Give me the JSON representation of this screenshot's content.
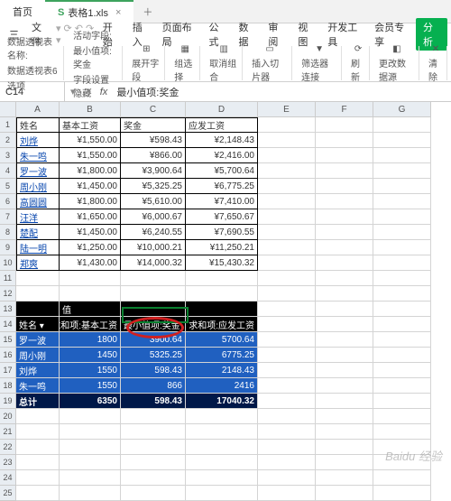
{
  "tabs": {
    "home": "首页",
    "file": "表格1.xls",
    "fileIcon": "S"
  },
  "menu": {
    "app": "三",
    "file": "文件",
    "items": [
      "开始",
      "插入",
      "页面布局",
      "公式",
      "数据",
      "审阅",
      "视图",
      "开发工具",
      "会员专享"
    ],
    "active": "分析"
  },
  "toolbar": {
    "g1a": "数据透视表名称:",
    "g1b": "数据透视表6",
    "g1c": "选项",
    "g2a": "活动字段:",
    "g2b": "最小值项:奖金",
    "g2c": "字段设置",
    "g2d": "隐藏",
    "g3": "展开字段",
    "g4": "组选择",
    "g5": "取消组合",
    "g6": "插入切片器",
    "g7": "筛选器连接",
    "g8": "刷新",
    "g9": "更改数据源",
    "g10": "清除"
  },
  "ref": {
    "cell": "C14",
    "formula": "最小值项:奖金",
    "fx": "fx"
  },
  "cols": [
    "A",
    "B",
    "C",
    "D",
    "E",
    "F",
    "G"
  ],
  "headers": {
    "name": "姓名",
    "base": "基本工资",
    "bonus": "奖金",
    "pay": "应发工资"
  },
  "rows": [
    {
      "n": "刘烨",
      "b": "¥1,550.00",
      "bo": "¥598.43",
      "p": "¥2,148.43"
    },
    {
      "n": "朱一鸣",
      "b": "¥1,550.00",
      "bo": "¥866.00",
      "p": "¥2,416.00"
    },
    {
      "n": "罗一波",
      "b": "¥1,800.00",
      "bo": "¥3,900.64",
      "p": "¥5,700.64"
    },
    {
      "n": "周小刚",
      "b": "¥1,450.00",
      "bo": "¥5,325.25",
      "p": "¥6,775.25"
    },
    {
      "n": "高圆圆",
      "b": "¥1,800.00",
      "bo": "¥5,610.00",
      "p": "¥7,410.00"
    },
    {
      "n": "汪洋",
      "b": "¥1,650.00",
      "bo": "¥6,000.67",
      "p": "¥7,650.67"
    },
    {
      "n": "楚配",
      "b": "¥1,450.00",
      "bo": "¥6,240.55",
      "p": "¥7,690.55"
    },
    {
      "n": "陆一明",
      "b": "¥1,250.00",
      "bo": "¥10,000.21",
      "p": "¥11,250.21"
    },
    {
      "n": "郑爽",
      "b": "¥1,430.00",
      "bo": "¥14,000.32",
      "p": "¥15,430.32"
    }
  ],
  "pivot": {
    "valLabel": "值",
    "h": {
      "name": "姓名",
      "sum_base": "求和项:基本工资",
      "min_bonus": "最小值项:奖金",
      "sum_pay": "求和项:应发工资"
    },
    "rows": [
      {
        "n": "罗一波",
        "b": "1800",
        "bo": "3900.64",
        "p": "5700.64"
      },
      {
        "n": "周小刚",
        "b": "1450",
        "bo": "5325.25",
        "p": "6775.25"
      },
      {
        "n": "刘烨",
        "b": "1550",
        "bo": "598.43",
        "p": "2148.43"
      },
      {
        "n": "朱一鸣",
        "b": "1550",
        "bo": "866",
        "p": "2416"
      }
    ],
    "tot": {
      "label": "总计",
      "b": "6350",
      "bo": "598.43",
      "p": "17040.32"
    }
  },
  "watermark": "Baidu 经验"
}
